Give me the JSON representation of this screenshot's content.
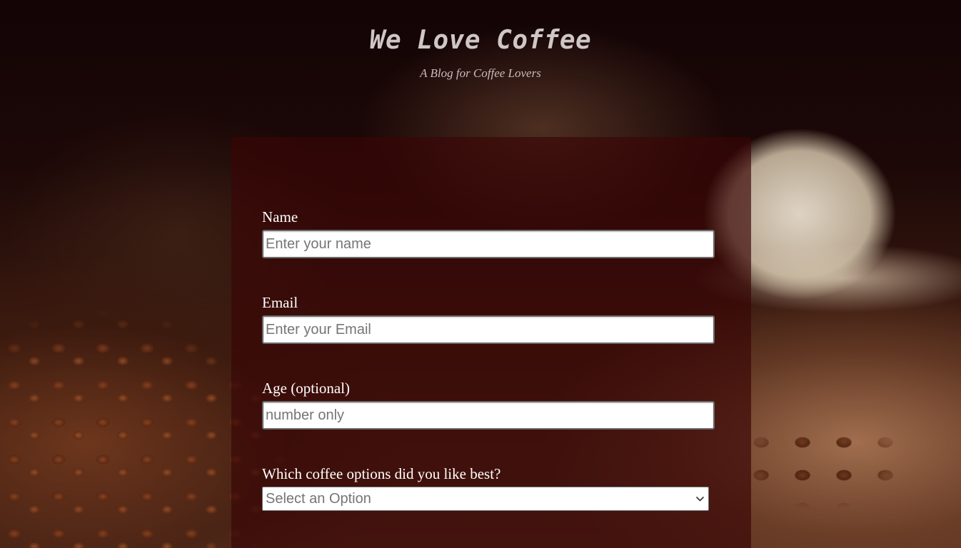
{
  "header": {
    "title": "We Love Coffee",
    "subtitle": "A Blog for Coffee Lovers"
  },
  "form": {
    "name": {
      "label": "Name",
      "placeholder": "Enter your name",
      "value": ""
    },
    "email": {
      "label": "Email",
      "placeholder": "Enter your Email",
      "value": ""
    },
    "age": {
      "label": "Age (optional)",
      "placeholder": "number only",
      "value": ""
    },
    "coffee_option": {
      "label": "Which coffee options did you like best?",
      "selected": "Select an Option"
    }
  },
  "colors": {
    "title_text": "#cfc6c6",
    "label_text": "#ffffff",
    "card_background": "rgba(58, 6, 6, 0.68)"
  },
  "icons": {
    "select_chevron": "chevron-down-icon"
  }
}
